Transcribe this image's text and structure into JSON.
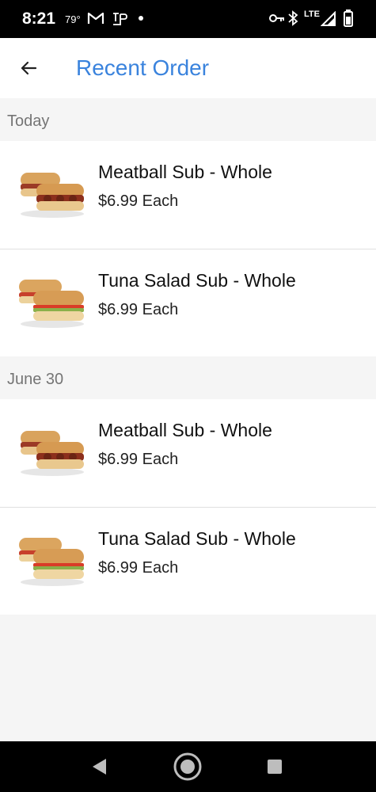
{
  "status_bar": {
    "time": "8:21",
    "temperature": "79°",
    "network": "LTE"
  },
  "header": {
    "title": "Recent Order"
  },
  "sections": [
    {
      "label": "Today",
      "items": [
        {
          "name": "Meatball Sub - Whole",
          "price": "$6.99 Each",
          "image": "meatball-sub"
        },
        {
          "name": "Tuna Salad Sub - Whole",
          "price": "$6.99 Each",
          "image": "tuna-sub"
        }
      ]
    },
    {
      "label": "June 30",
      "items": [
        {
          "name": "Meatball Sub - Whole",
          "price": "$6.99 Each",
          "image": "meatball-sub"
        },
        {
          "name": "Tuna Salad Sub - Whole",
          "price": "$6.99 Each",
          "image": "tuna-sub"
        }
      ]
    }
  ],
  "colors": {
    "accent": "#3a83dd",
    "background": "#f5f5f5",
    "section_label": "#757575"
  }
}
